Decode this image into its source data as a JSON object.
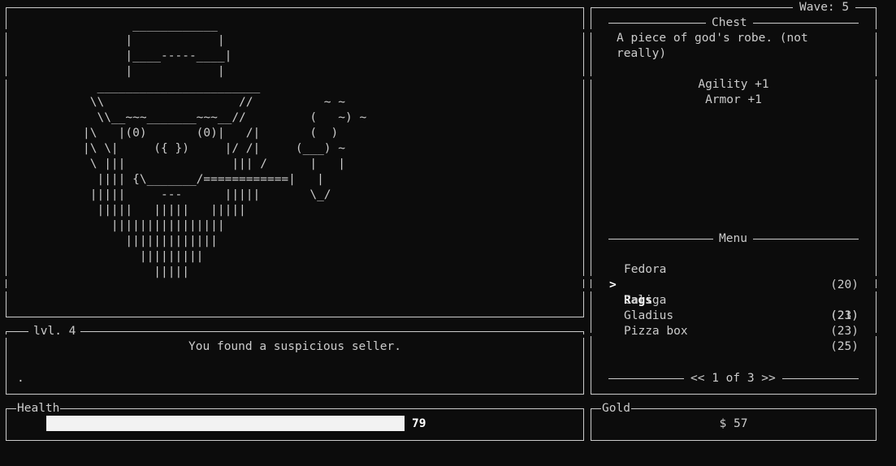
{
  "art": {
    "lines": [
      "       ____________",
      "      |            |",
      "      |____-----____|",
      "      |            |",
      "  _______________________",
      " \\\\                   //          ~ ~",
      "  \\\\__~~~_______~~~__//         (   ~) ~",
      "|\\   |(0)       (0)|   /|       (  )",
      "|\\ \\|     ({ })     |/ /|     (___) ~",
      " \\ |||               ||| /      |   |",
      "  |||| {\\_______/============|   |",
      " |||||     ---      |||||       \\_/",
      "  |||||   |||||   |||||",
      "    ||||||||||||||||",
      "      |||||||||||||",
      "        |||||||||",
      "          |||||"
    ]
  },
  "level": {
    "label": "lvl. 4"
  },
  "log": {
    "message": "You found a suspicious seller.",
    "prompt": "."
  },
  "health": {
    "label": "Health",
    "value": 79,
    "fill_fraction": 1.0,
    "bar_color": "#f2f2f2"
  },
  "wave": {
    "label": "Wave: 5"
  },
  "chest": {
    "title": "Chest",
    "description": "A piece of god's robe. (not\nreally)",
    "stats": [
      "Agility +1",
      "Armor +1"
    ]
  },
  "menu": {
    "title": "Menu",
    "cursor": ">",
    "items": [
      {
        "name": "Fedora",
        "price": "(20)",
        "selected": false
      },
      {
        "name": "Rags",
        "price": "(23)",
        "selected": true
      },
      {
        "name": "Caliga",
        "price": "(21)",
        "selected": false
      },
      {
        "name": "Gladius",
        "price": "(23)",
        "selected": false
      },
      {
        "name": "Pizza box",
        "price": "(25)",
        "selected": false
      }
    ],
    "pager": "<< 1 of 3 >>"
  },
  "gold": {
    "label": "Gold",
    "amount": "$ 57"
  },
  "colors": {
    "background": "#0c0c0c",
    "foreground": "#cccccc",
    "highlight": "#ffffff"
  }
}
